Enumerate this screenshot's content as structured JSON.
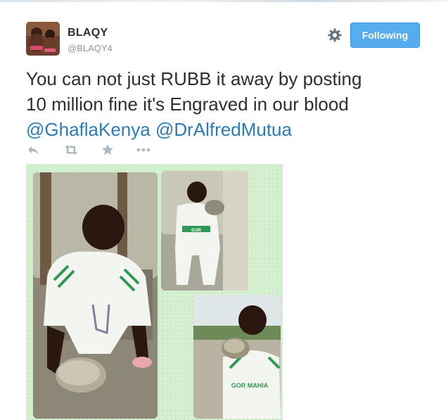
{
  "user": {
    "name": "BLAQY",
    "handle": "@BLAQY4"
  },
  "follow_button": {
    "label": "Following"
  },
  "tweet": {
    "line1": "You can not just RUBB it away by posting",
    "line2": "10 million fine it's Engraved in our blood",
    "mention1": "@GhaflaKenya",
    "mention2": "@DrAlfredMutua"
  },
  "photo": {
    "jersey_text": "GOR MAHIA"
  },
  "actions": [
    "reply-icon",
    "retweet-icon",
    "favorite-icon",
    "more-icon"
  ],
  "colors": {
    "accent": "#55acee",
    "mention": "#2b7bb9",
    "text": "#292f33",
    "muted": "#8899a6",
    "icon": "#aab8c2"
  }
}
